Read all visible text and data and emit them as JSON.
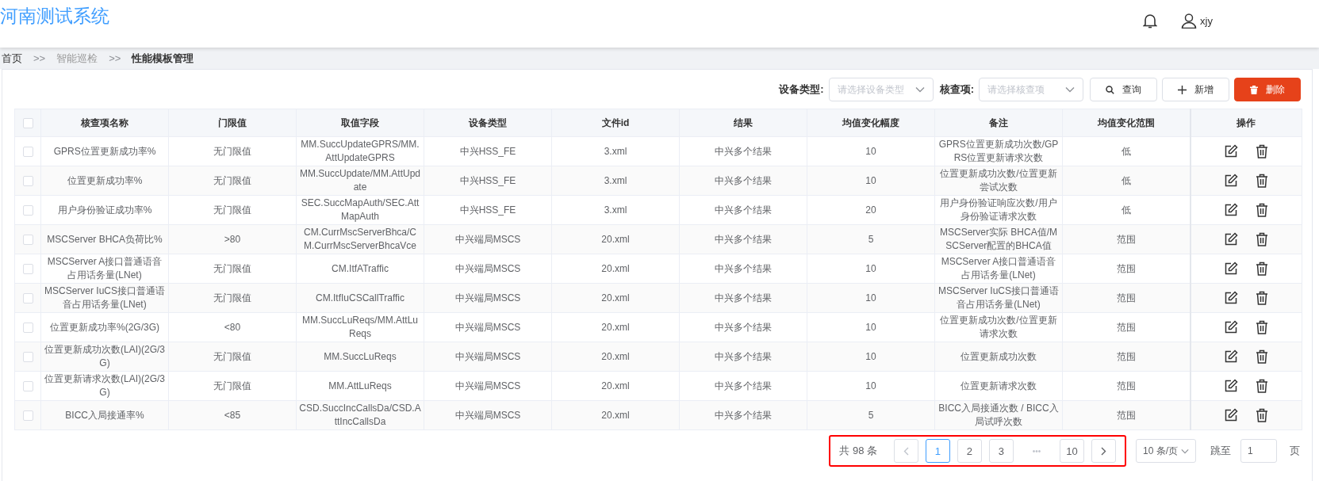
{
  "app": {
    "title": "河南测试系统",
    "user": "xjy"
  },
  "breadcrumb": {
    "separator": ">>",
    "items": [
      {
        "label": "首页",
        "kind": "link"
      },
      {
        "label": "智能巡检",
        "kind": "muted"
      },
      {
        "label": "性能模板管理",
        "kind": "current"
      }
    ]
  },
  "filters": [
    {
      "label": "设备类型:",
      "placeholder": "请选择设备类型"
    },
    {
      "label": "核查项:",
      "placeholder": "请选择核查项"
    }
  ],
  "buttons": [
    {
      "label": "查询",
      "kind": "search"
    },
    {
      "label": "新增",
      "kind": "add"
    },
    {
      "label": "删除",
      "kind": "danger"
    }
  ],
  "table": {
    "select_all": {
      "checked": false
    },
    "columns": [
      "核查项名称",
      "门限值",
      "取值字段",
      "设备类型",
      "文件id",
      "结果",
      "均值变化幅度",
      "备注",
      "均值变化范围",
      "操作"
    ],
    "rows": [
      {
        "selected": false,
        "cells": [
          "GPRS位置更新成功率%",
          "无门限值",
          "MM.SuccUpdateGPRS/MM.AttUpdateGPRS",
          "中兴HSS_FE",
          "3.xml",
          "中兴多个结果",
          "10",
          "GPRS位置更新成功次数/GPRS位置更新请求次数",
          "低"
        ]
      },
      {
        "selected": false,
        "cells": [
          "位置更新成功率%",
          "无门限值",
          "MM.SuccUpdate/MM.AttUpdate",
          "中兴HSS_FE",
          "3.xml",
          "中兴多个结果",
          "10",
          "位置更新成功次数/位置更新尝试次数",
          "低"
        ]
      },
      {
        "selected": false,
        "cells": [
          "用户身份验证成功率%",
          "无门限值",
          "SEC.SuccMapAuth/SEC.AttMapAuth",
          "中兴HSS_FE",
          "3.xml",
          "中兴多个结果",
          "20",
          "用户身份验证响应次数/用户身份验证请求次数",
          "低"
        ]
      },
      {
        "selected": false,
        "cells": [
          "MSCServer BHCA负荷比%",
          ">80",
          "CM.CurrMscServerBhca/CM.CurrMscServerBhcaVce",
          "中兴端局MSCS",
          "20.xml",
          "中兴多个结果",
          "5",
          "MSCServer实际 BHCA值/MSCServer配置的BHCA值",
          "范围"
        ]
      },
      {
        "selected": false,
        "cells": [
          "MSCServer A接口普通语音占用话务量(LNet)",
          "无门限值",
          "CM.ItfATraffic",
          "中兴端局MSCS",
          "20.xml",
          "中兴多个结果",
          "10",
          "MSCServer A接口普通语音占用话务量(LNet)",
          "范围"
        ]
      },
      {
        "selected": false,
        "cells": [
          "MSCServer IuCS接口普通语音占用话务量(LNet)",
          "无门限值",
          "CM.ItfIuCSCallTraffic",
          "中兴端局MSCS",
          "20.xml",
          "中兴多个结果",
          "10",
          "MSCServer IuCS接口普通语音占用话务量(LNet)",
          "范围"
        ]
      },
      {
        "selected": false,
        "cells": [
          "位置更新成功率%(2G/3G)",
          "<80",
          "MM.SuccLuReqs/MM.AttLuReqs",
          "中兴端局MSCS",
          "20.xml",
          "中兴多个结果",
          "10",
          "位置更新成功次数/位置更新请求次数",
          "范围"
        ]
      },
      {
        "selected": false,
        "cells": [
          "位置更新成功次数(LAI)(2G/3G)",
          "无门限值",
          "MM.SuccLuReqs",
          "中兴端局MSCS",
          "20.xml",
          "中兴多个结果",
          "10",
          "位置更新成功次数",
          "范围"
        ]
      },
      {
        "selected": false,
        "cells": [
          "位置更新请求次数(LAI)(2G/3G)",
          "无门限值",
          "MM.AttLuReqs",
          "中兴端局MSCS",
          "20.xml",
          "中兴多个结果",
          "10",
          "位置更新请求次数",
          "范围"
        ]
      },
      {
        "selected": false,
        "cells": [
          "BICC入局接通率%",
          "<85",
          "CSD.SuccIncCallsDa/CSD.AttIncCallsDa",
          "中兴端局MSCS",
          "20.xml",
          "中兴多个结果",
          "5",
          "BICC入局接通次数 / BICC入局试呼次数",
          "范围"
        ]
      }
    ]
  },
  "pagination": {
    "total": "共 98 条",
    "prev": {
      "disabled": true
    },
    "next": {
      "disabled": false
    },
    "pages": [
      {
        "label": "1",
        "selected": true
      },
      {
        "label": "2",
        "selected": false
      },
      {
        "label": "3",
        "selected": false
      },
      {
        "label": "•••",
        "kind": "ellipsis",
        "selected": false
      },
      {
        "label": "10",
        "selected": false
      }
    ],
    "page_size": "10 条/页",
    "jump_label": "跳至",
    "jump_value": "1",
    "jump_suffix": "页"
  }
}
